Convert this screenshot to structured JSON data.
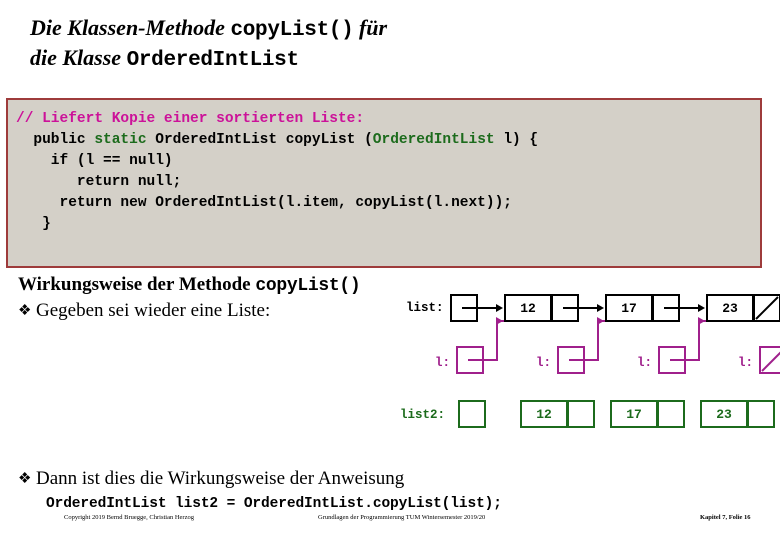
{
  "slide": {
    "title": {
      "line1_pre": "Die Klassen-Methode ",
      "line1_code": "copyList()",
      "line1_post": " für",
      "line2_pre": "die Klasse ",
      "line2_code": "OrderedIntList"
    },
    "code_block": {
      "comment": "// Liefert Kopie einer sortierten Liste:",
      "line2_a": "  public ",
      "line2_static": "static",
      "line2_b": " OrderedIntList copyList (",
      "line2_type": "OrderedIntList",
      "line2_c": " l) {",
      "line3": "    if (l == null)",
      "line4": "       return null;",
      "line5": "     return new OrderedIntList(l.item, copyList(l.next));",
      "line6": "   }"
    },
    "subhead": {
      "text": "Wirkungsweise der Methode ",
      "code": "copyList()"
    },
    "bullet1": {
      "mark": "diamond-bullet-icon",
      "glyph": "❖",
      "text": "Gegeben sei wieder eine Liste:"
    },
    "bullet2": {
      "mark": "diamond-bullet-icon",
      "glyph": "❖",
      "text": "Dann ist dies die Wirkungsweise der Anweisung"
    },
    "statement": "OrderedIntList list2 = OrderedIntList.copyList(list);",
    "diagram": {
      "list_label": "list:",
      "list2_label": "list2:",
      "frame_label": "l:",
      "list_values": [
        "12",
        "17",
        "23"
      ],
      "list2_values": [
        "12",
        "17",
        "23"
      ],
      "frame_count": 4,
      "null_marker": "slash-null-icon",
      "colors": {
        "list_row": "#000000",
        "frames": "#a0208c",
        "list2_row": "#1c6b1c"
      }
    },
    "footer": {
      "left": "Copyright 2019 Bernd Bruegge, Christian Herzog",
      "center": "Grundlagen der Programmierung  TUM Wintersemester 2019/20",
      "right": "Kapitel 7, Folie 16"
    },
    "colors": {
      "code_bg": "#d4d0c8",
      "code_border": "#9e3b3b",
      "comment": "#cc1199",
      "keyword": "#1c6b1c"
    }
  }
}
